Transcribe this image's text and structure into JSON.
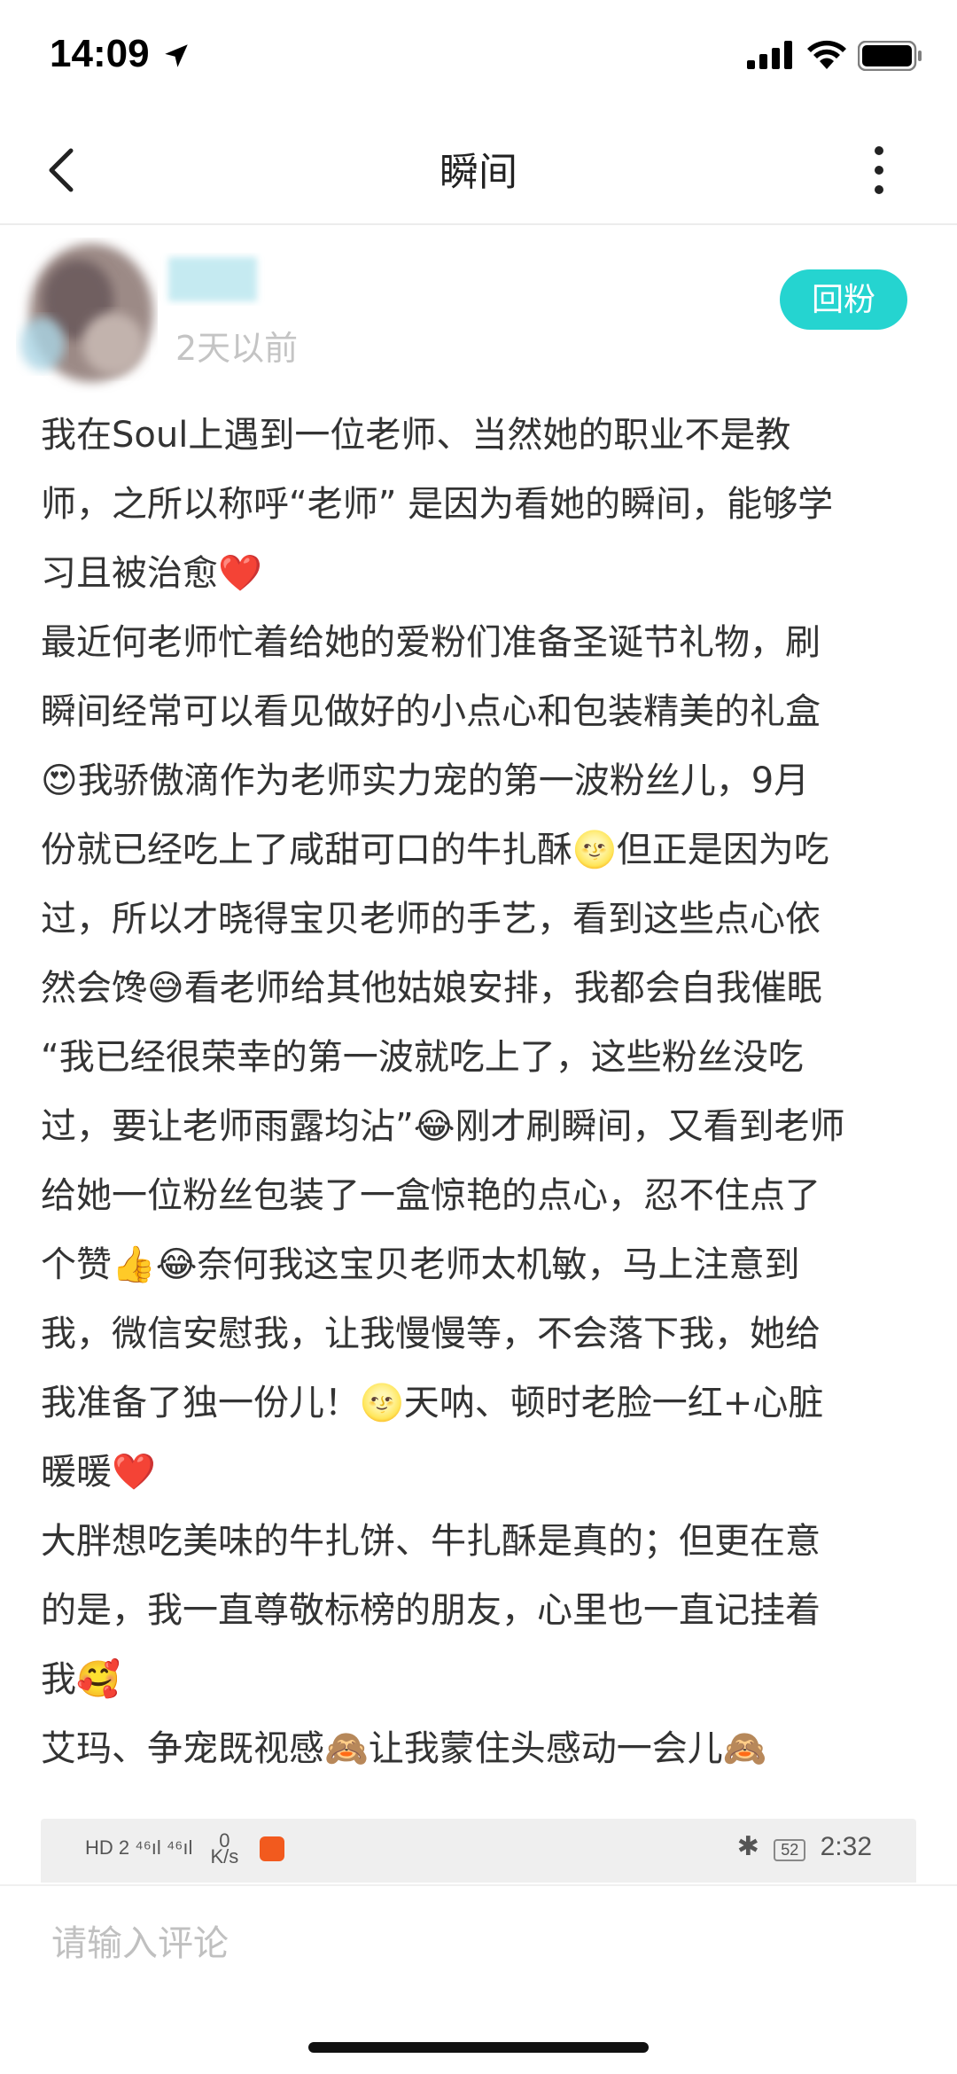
{
  "status": {
    "time": "14:09",
    "icons": [
      "location-arrow-icon",
      "signal-icon",
      "wifi-icon",
      "battery-icon"
    ]
  },
  "nav": {
    "title": "瞬间",
    "back_icon": "chevron-left-icon",
    "more_icon": "more-vertical-icon"
  },
  "post": {
    "time": "2天以前",
    "follow_label": "回粉",
    "lines": [
      "我在Soul上遇到一位老师、当然她的职业不是教",
      "师，之所以称呼“老师” 是因为看她的瞬间，能够学",
      "习且被治愈❤️",
      "最近何老师忙着给她的爱粉们准备圣诞节礼物，刷",
      "瞬间经常可以看见做好的小点心和包装精美的礼盒",
      "😍我骄傲滴作为老师实力宠的第一波粉丝儿，9月",
      "份就已经吃上了咸甜可口的牛扎酥🌝但正是因为吃",
      "过，所以才晓得宝贝老师的手艺，看到这些点心依",
      "然会馋😅看老师给其他姑娘安排，我都会自我催眠",
      "“我已经很荣幸的第一波就吃上了，这些粉丝没吃",
      "过，要让老师雨露均沾”😂刚才刷瞬间，又看到老师",
      "给她一位粉丝包装了一盒惊艳的点心，忍不住点了",
      "个赞👍😂奈何我这宝贝老师太机敏，马上注意到",
      "我，微信安慰我，让我慢慢等，不会落下我，她给",
      "我准备了独一份儿！🌝天呐、顿时老脸一红+心脏",
      "暖暖❤️",
      "大胖想吃美味的牛扎饼、牛扎酥是真的；但更在意",
      "的是，我一直尊敬标榜的朋友，心里也一直记挂着",
      "我🥰",
      "艾玛、争宠既视感🙈让我蒙住头感动一会儿🙈"
    ]
  },
  "image_preview": {
    "left_text": "HD 2  ⁴⁶ıl ⁴⁶ıl",
    "speed_value": "0",
    "speed_unit": "K/s",
    "battery": "52",
    "time": "2:32"
  },
  "comment": {
    "placeholder": "请输入评论"
  }
}
